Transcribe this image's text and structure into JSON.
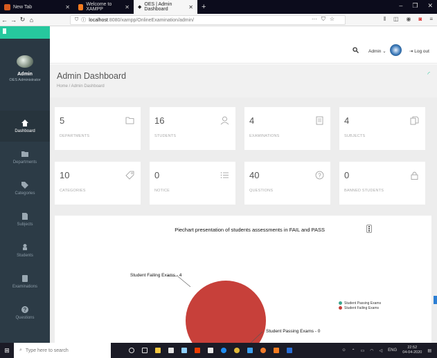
{
  "browser": {
    "tabs": [
      {
        "label": "New Tab",
        "fav_color": "#d65a1f"
      },
      {
        "label": "Welcome to XAMPP",
        "fav_color": "#f47b20"
      },
      {
        "label": "OES | Admin Dashboard",
        "fav_color": "#333333"
      }
    ],
    "url_host": "localhost",
    "url_path": ":8080/xampp/OnlineExamination/admin/"
  },
  "sidebar": {
    "user_name": "Admin",
    "user_role": "OES Administrator",
    "items": [
      {
        "label": "Dashboard",
        "icon": "home-icon"
      },
      {
        "label": "Departments",
        "icon": "folder-icon"
      },
      {
        "label": "Categories",
        "icon": "tag-icon"
      },
      {
        "label": "Subjects",
        "icon": "document-icon"
      },
      {
        "label": "Students",
        "icon": "user-icon"
      },
      {
        "label": "Examinations",
        "icon": "book-icon"
      },
      {
        "label": "Questions",
        "icon": "question-icon"
      }
    ]
  },
  "header": {
    "user_menu": "Admin",
    "logout": "Log out"
  },
  "page": {
    "title": "Admin Dashboard",
    "breadcrumb": "Home  /  Admin Dashboard"
  },
  "cards": [
    {
      "value": "5",
      "label": "DEPARTMENTS",
      "icon": "folder-icon"
    },
    {
      "value": "16",
      "label": "STUDENTS",
      "icon": "user-icon"
    },
    {
      "value": "4",
      "label": "EXAMINATIONS",
      "icon": "book-icon"
    },
    {
      "value": "4",
      "label": "SUBJECTS",
      "icon": "copy-icon"
    },
    {
      "value": "10",
      "label": "CATEGORIES",
      "icon": "tag-icon"
    },
    {
      "value": "0",
      "label": "NOTICE",
      "icon": "list-icon"
    },
    {
      "value": "40",
      "label": "QUESTIONS",
      "icon": "question-icon"
    },
    {
      "value": "0",
      "label": "BANNED STUDENTS",
      "icon": "lock-icon"
    }
  ],
  "chart_data": {
    "type": "pie",
    "title": "Piechart presentation of students assessments in FAIL and PASS",
    "series": [
      {
        "name": "Student Passing Exams",
        "value": 0,
        "color": "#3aa68e"
      },
      {
        "name": "Student Failing Exams",
        "value": 4,
        "color": "#c7403a"
      }
    ],
    "slice_labels": [
      "Student Passing Exams - 0",
      "Student Failing Exams - 4"
    ],
    "legend": "right"
  },
  "taskbar": {
    "search_placeholder": "Type here to search",
    "language": "ENG",
    "time": "22:52",
    "date": "04-04-2020"
  }
}
